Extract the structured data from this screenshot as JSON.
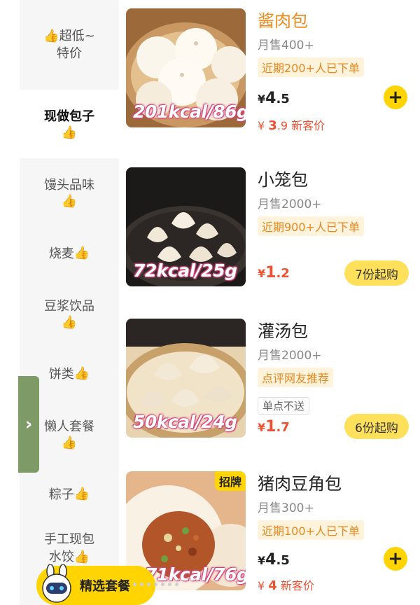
{
  "sidebar": {
    "categories": [
      {
        "label": "超低~",
        "label2": "特价",
        "thumb": "👍"
      },
      {
        "label": "现做包子",
        "thumb": "👍"
      },
      {
        "label": "馒头品味",
        "thumb": "👍"
      },
      {
        "label": "烧麦",
        "thumb": "👍"
      },
      {
        "label": "豆浆饮品",
        "thumb": "👍"
      },
      {
        "label": "饼类",
        "thumb": "👍"
      },
      {
        "label": "懒人套餐",
        "thumb": "👍"
      },
      {
        "label": "粽子",
        "thumb": "👍"
      },
      {
        "label": "手工现包",
        "label2": "水饺",
        "thumb": "👍"
      }
    ],
    "active_index": 1,
    "handle_icon": "chevron-right-icon",
    "handle_glyph": "›"
  },
  "products": [
    {
      "name": "酱肉包",
      "sales": "月售400+",
      "tag": "近期200+人已下单",
      "kcal": "201kcal/86g",
      "price_symbol": "¥",
      "price_int": "4",
      "price_dec": ".5",
      "new_price_symbol": "¥",
      "new_price_int": "3",
      "new_price_dec": ".9",
      "new_price_label": "新客价",
      "add_glyph": "+"
    },
    {
      "name": "小笼包",
      "sales": "月售2000+",
      "tag": "近期900+人已下单",
      "kcal": "72kcal/25g",
      "price_symbol": "¥",
      "price_int": "1",
      "price_dec": ".2",
      "min_buy": "7份起购"
    },
    {
      "name": "灌汤包",
      "sales": "月售2000+",
      "tag": "点评网友推荐",
      "tag2": "单点不送",
      "kcal": "50kcal/24g",
      "price_symbol": "¥",
      "price_int": "1",
      "price_dec": ".7",
      "min_buy": "6份起购"
    },
    {
      "name": "猪肉豆角包",
      "sales": "月售300+",
      "tag": "近期100+人已下单",
      "kcal": "171kcal/76g",
      "sign_badge": "招牌",
      "price_symbol": "¥",
      "price_int": "4",
      "price_dec": ".5",
      "new_price_symbol": "¥",
      "new_price_int": "4",
      "new_price_label": "新客价",
      "add_glyph": "+"
    }
  ],
  "float_button": {
    "label": "精选套餐"
  },
  "colors": {
    "accent": "#ffd400",
    "price_red": "#f05032",
    "tag_orange": "#e8871e",
    "handle_green": "#7e9a66"
  }
}
